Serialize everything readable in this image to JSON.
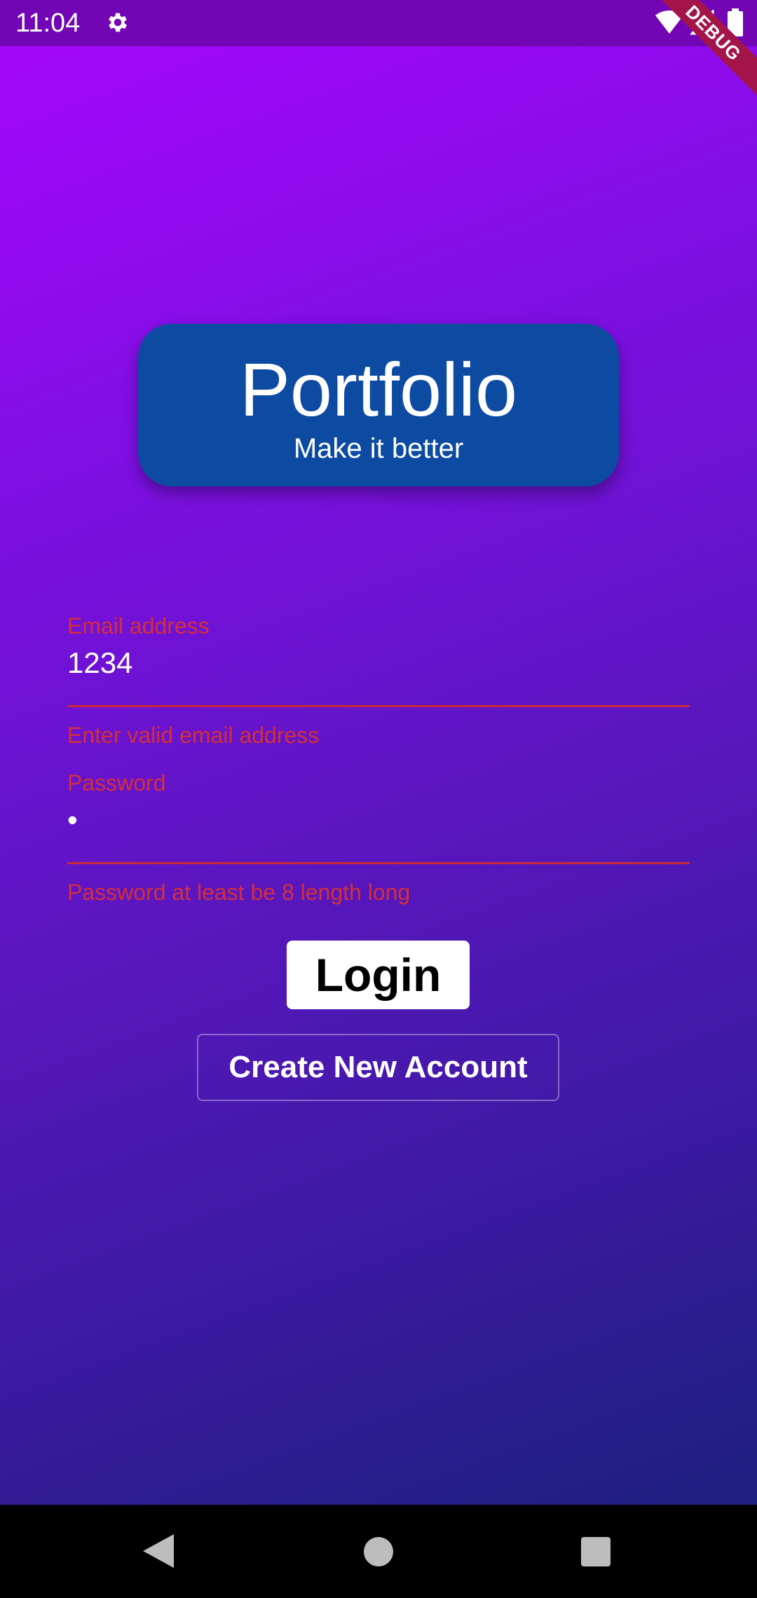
{
  "status_bar": {
    "time": "11:04",
    "icons": [
      "gear-icon",
      "wifi-icon",
      "signal-icon",
      "battery-icon"
    ]
  },
  "debug_banner": "DEBUG",
  "logo": {
    "title": "Portfolio",
    "subtitle": "Make it better"
  },
  "form": {
    "email": {
      "label": "Email address",
      "value": "1234",
      "error": "Enter valid email address"
    },
    "password": {
      "label": "Password",
      "value": "•",
      "error": "Password at least be 8 length long"
    }
  },
  "buttons": {
    "login": "Login",
    "create_account": "Create New Account"
  },
  "colors": {
    "gradient_top": "#a806fb",
    "gradient_bottom": "#1d1f7e",
    "logo_card": "#0d4ba3",
    "error": "#d32f3a",
    "status_bar": "#7206b4"
  },
  "nav_bar": {
    "icons": [
      "back-icon",
      "home-icon",
      "recents-icon"
    ]
  }
}
